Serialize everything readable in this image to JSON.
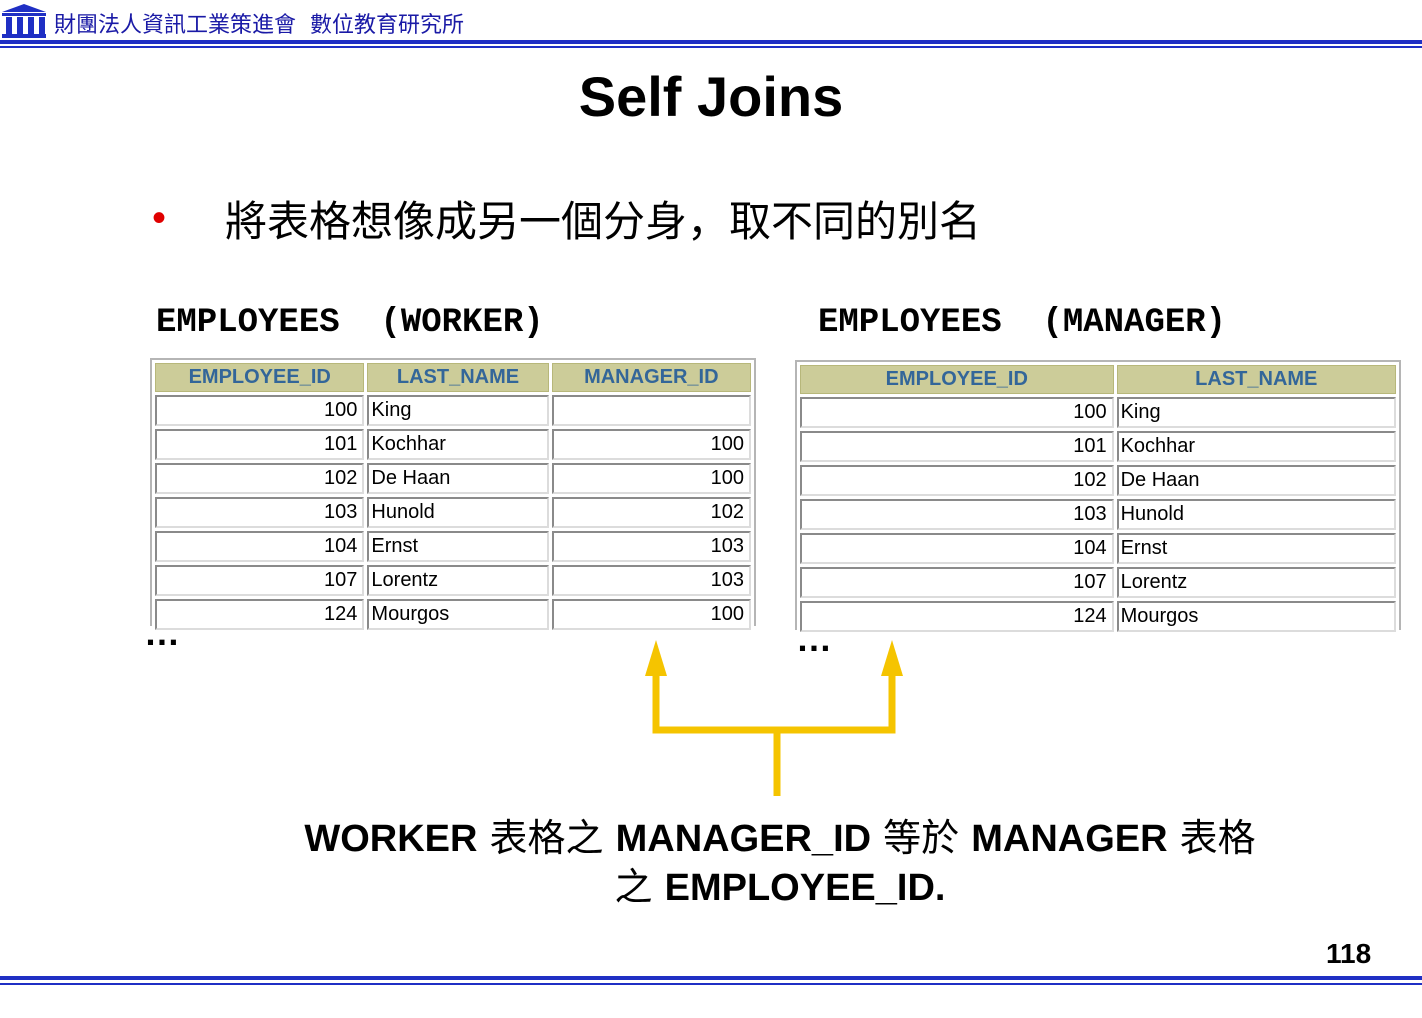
{
  "header": {
    "org_name": "財團法人資訊工業策進會",
    "institute": "數位教育研究所"
  },
  "slide": {
    "title": "Self Joins",
    "bullet_mark": "•",
    "bullet": "將表格想像成另一個分身，取不同的別名",
    "page_number": "118"
  },
  "worker_table": {
    "title": "EMPLOYEES  (WORKER)",
    "columns": [
      "EMPLOYEE_ID",
      "LAST_NAME",
      "MANAGER_ID"
    ],
    "rows": [
      [
        "100",
        "King",
        ""
      ],
      [
        "101",
        "Kochhar",
        "100"
      ],
      [
        "102",
        "De Haan",
        "100"
      ],
      [
        "103",
        "Hunold",
        "102"
      ],
      [
        "104",
        "Ernst",
        "103"
      ],
      [
        "107",
        "Lorentz",
        "103"
      ],
      [
        "124",
        "Mourgos",
        "100"
      ]
    ],
    "more": "…"
  },
  "manager_table": {
    "title": "EMPLOYEES  (MANAGER)",
    "columns": [
      "EMPLOYEE_ID",
      "LAST_NAME"
    ],
    "rows": [
      [
        "100",
        "King"
      ],
      [
        "101",
        "Kochhar"
      ],
      [
        "102",
        "De Haan"
      ],
      [
        "103",
        "Hunold"
      ],
      [
        "104",
        "Ernst"
      ],
      [
        "107",
        "Lorentz"
      ],
      [
        "124",
        "Mourgos"
      ]
    ],
    "more": "…"
  },
  "caption": {
    "w1": "WORKER",
    "c1": " 表格之 ",
    "w2": "MANAGER_ID",
    "c2": " 等於 ",
    "w3": "MANAGER",
    "c3": " 表格",
    "c4": "之 ",
    "w4": "EMPLOYEE_ID."
  },
  "colors": {
    "header_rule": "#1f2fc4",
    "column_header_bg": "#cccc99",
    "column_header_text": "#336699",
    "arrow": "#f5c400",
    "bullet": "#e00000"
  }
}
